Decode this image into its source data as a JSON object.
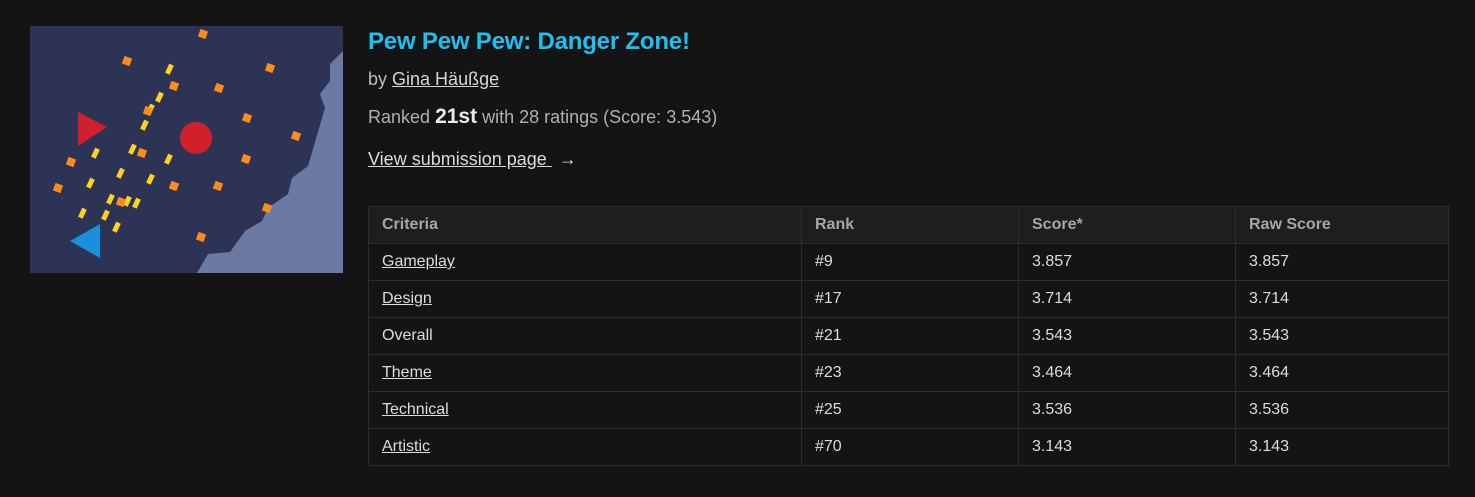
{
  "game": {
    "title": "Pew Pew Pew: Danger Zone!",
    "by_label": "by",
    "author": "Gina Häußge",
    "ranked_label": "Ranked",
    "rank": "21st",
    "rank_detail": "with 28 ratings (Score: 3.543)",
    "view_link": "View submission page",
    "view_arrow": "→"
  },
  "thumbnail": {
    "background": "#2d3354",
    "terrain_color": "#6b7aa3",
    "enemy_color": "#d0202c",
    "player_color": "#1c8fdc",
    "bullet_color": "#ffd21e",
    "pickup_color": "#ff8c1a"
  },
  "table": {
    "headers": [
      "Criteria",
      "Rank",
      "Score*",
      "Raw Score"
    ],
    "rows": [
      {
        "criteria": "Gameplay",
        "rank": "#9",
        "score": "3.857",
        "raw": "3.857",
        "link": true
      },
      {
        "criteria": "Design",
        "rank": "#17",
        "score": "3.714",
        "raw": "3.714",
        "link": true
      },
      {
        "criteria": "Overall",
        "rank": "#21",
        "score": "3.543",
        "raw": "3.543",
        "link": false
      },
      {
        "criteria": "Theme",
        "rank": "#23",
        "score": "3.464",
        "raw": "3.464",
        "link": true
      },
      {
        "criteria": "Technical",
        "rank": "#25",
        "score": "3.536",
        "raw": "3.536",
        "link": true
      },
      {
        "criteria": "Artistic",
        "rank": "#70",
        "score": "3.143",
        "raw": "3.143",
        "link": true
      }
    ]
  }
}
